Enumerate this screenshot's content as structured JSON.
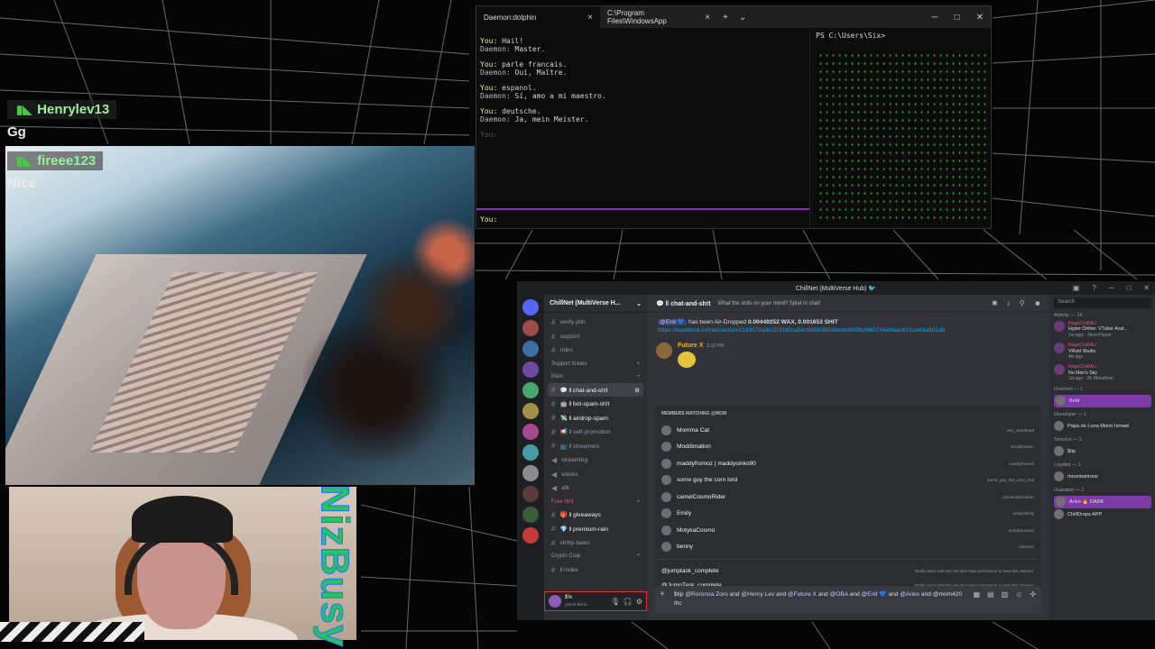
{
  "stream_chat": [
    {
      "user": "Henrylev13",
      "text": "Gg"
    },
    {
      "user": "fireee123",
      "text": "Nice"
    }
  ],
  "overlay_name": "NizBusy",
  "terminal": {
    "tabs": [
      {
        "label": "Daemon:dolphin"
      },
      {
        "label": "C:\\Program Files\\WindowsApp"
      }
    ],
    "new_tab": "+",
    "dropdown": "⌄",
    "lines": [
      {
        "who": "You:",
        "text": "Hail!"
      },
      {
        "who": "Daemon:",
        "text": "Master."
      },
      {
        "who": "You:",
        "text": "parle francais."
      },
      {
        "who": "Daemon:",
        "text": "Oui, Maître."
      },
      {
        "who": "You:",
        "text": "espanol."
      },
      {
        "who": "Daemon:",
        "text": "Sí, amo a mi maestro."
      },
      {
        "who": "You:",
        "text": "deutsche."
      },
      {
        "who": "Daemon:",
        "text": "Ja, mein Meister."
      }
    ],
    "prompt_dim": "You:",
    "prompt": "You:",
    "ps_prompt": "PS C:\\Users\\Six>"
  },
  "discord": {
    "window_title": "ChillNet (MultiVerse Hub) 🐦",
    "server_name": "ChillNet (MultiVerse H...",
    "channels": [
      {
        "type": "channel",
        "name": "verify-join"
      },
      {
        "type": "channel",
        "name": "support"
      },
      {
        "type": "channel",
        "name": "roles"
      },
      {
        "type": "category",
        "name": "Support tickets"
      },
      {
        "type": "category",
        "name": "Main"
      },
      {
        "type": "channel",
        "name": "💬 ‖ chat-and-sh!t",
        "active": true
      },
      {
        "type": "channel",
        "name": "🤖 ‖ bot-spam-sh!t",
        "bold": true
      },
      {
        "type": "channel",
        "name": "💸 ‖ airdrop-spam",
        "bold": true
      },
      {
        "type": "channel",
        "name": "📢 ‖ self-promotion"
      },
      {
        "type": "channel",
        "name": "📺 ‖ streamers"
      },
      {
        "type": "channel",
        "name": "streaming"
      },
      {
        "type": "channel",
        "name": "voices"
      },
      {
        "type": "channel",
        "name": "afk"
      },
      {
        "type": "category",
        "name": "Free Sh!t"
      },
      {
        "type": "channel",
        "name": "🎁 ‖ giveaways",
        "bold": true
      },
      {
        "type": "channel",
        "name": "💎 ‖ premium-rain",
        "bold": true
      },
      {
        "type": "channel",
        "name": "sh!tty-tasks"
      },
      {
        "type": "category",
        "name": "Crypto Crap"
      },
      {
        "type": "channel",
        "name": "‖ index"
      }
    ],
    "channel_header": {
      "name": "💬 ‖ chat-and-sh!t",
      "topic": "What the shits on your mind? Splat in chat!"
    },
    "airdrop": {
      "mention": "@Enit 💙",
      "text": "has been Air-Dropped",
      "amount": "0.00449252 WAX, 0.001653 SHIT",
      "link": "https://waxblock.io/transaction/c1d3575a3e1531d5ca3ec95863803feddc6006cf460704e0aac621ce6da5d1ab"
    },
    "future_msg": {
      "author": "Future X",
      "time": "2:32 PM"
    },
    "members_header": "MEMBERS MATCHING @MOM",
    "members": [
      {
        "name": "Momma Cat",
        "user": "mm_undefined"
      },
      {
        "name": "Moddimation",
        "user": "moddimation"
      },
      {
        "name": "maddyfromoz | maddysinko90",
        "user": "maddyfromoz"
      },
      {
        "name": "some guy the corn lord",
        "user": "some_guy_the_corn_lord"
      },
      {
        "name": "camelCosmoRider",
        "user": "camelcosmorider"
      },
      {
        "name": "Emily",
        "user": "emilyOwnly"
      },
      {
        "name": "MotykaCosmo",
        "user": "motykacosmo"
      },
      {
        "name": "benny",
        "user": "rianomo"
      }
    ],
    "roles": [
      {
        "name": "@jumptask_complete",
        "desc": "Notify users with this role who have permission to view this channel."
      },
      {
        "name": "@JumpTask_complete",
        "desc": "Notify users with this role who have permission to view this channel."
      }
    ],
    "composer": {
      "pre": "$tip",
      "mentions": [
        "@Roronoa Zoro",
        "@Henry Lev",
        "@Future X",
        "@OBA",
        "@Enit 💙",
        "@Aries"
      ],
      "joiner": "and",
      "tail": "@mom420 thc"
    },
    "userbar": {
      "name": "$!x",
      "status": "you're the b..."
    },
    "search_placeholder": "Search",
    "activity_label": "Activity — 24",
    "activities": [
      {
        "user": "RageCraftAU",
        "title": "Hyper Online: VTuber Avat...",
        "meta": "1w ago · New Player"
      },
      {
        "user": "RageCraftAU",
        "title": "VRoid Studio",
        "meta": "4d ago"
      },
      {
        "user": "RageCraftAU",
        "title": "No Man's Sky",
        "meta": "1d ago · 2h Marathon"
      }
    ],
    "groups": [
      {
        "label": "Overlord — 1",
        "members": [
          {
            "name": "Bebi",
            "sub": "you're the boss boss?",
            "hl": true
          }
        ]
      },
      {
        "label": "Developer — 1",
        "members": [
          {
            "name": "Papa de Luna Morin Ismael",
            "sub": ""
          }
        ]
      },
      {
        "label": "Terrorist — 1",
        "members": [
          {
            "name": "$tip",
            "sub": "I'm a flytrap"
          }
        ]
      },
      {
        "label": "Loyalist — 1",
        "members": [
          {
            "name": "mountainrose",
            "sub": ""
          }
        ]
      },
      {
        "label": "Guardian — 1",
        "members": [
          {
            "name": "Aries 🔥 DARK",
            "sub": "",
            "hl": true
          },
          {
            "name": "ChillDrops APP",
            "sub": ""
          }
        ]
      }
    ]
  },
  "colors": {
    "accent": "#8b2bb9",
    "matrix": "#3bd93b",
    "mention": "#c9cdfb",
    "link": "#00a8fc",
    "chat_name": "#9df09d"
  }
}
